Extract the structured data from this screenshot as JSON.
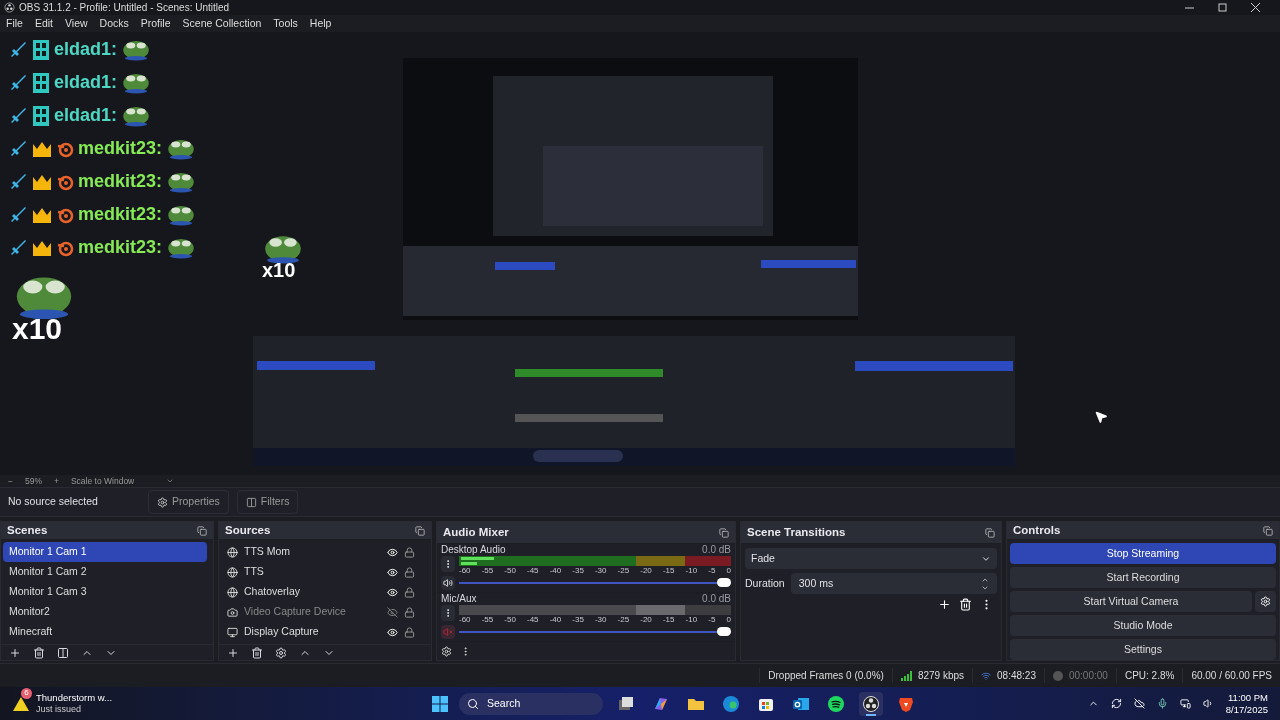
{
  "window": {
    "title": "OBS 31.1.2 - Profile: Untitled - Scenes: Untitled"
  },
  "menu": [
    "File",
    "Edit",
    "View",
    "Docks",
    "Profile",
    "Scene Collection",
    "Tools",
    "Help"
  ],
  "preview": {
    "chat": [
      {
        "user": "eldad1:",
        "color": "#4dd8c4",
        "kind": "og"
      },
      {
        "user": "eldad1:",
        "color": "#4dd8c4",
        "kind": "og"
      },
      {
        "user": "eldad1:",
        "color": "#4dd8c4",
        "kind": "og"
      },
      {
        "user": "medkit23:",
        "color": "#86ea55",
        "kind": "crown"
      },
      {
        "user": "medkit23:",
        "color": "#86ea55",
        "kind": "crown"
      },
      {
        "user": "medkit23:",
        "color": "#86ea55",
        "kind": "crown"
      },
      {
        "user": "medkit23:",
        "color": "#86ea55",
        "kind": "crown"
      }
    ],
    "multipliers": [
      "x10",
      "x10"
    ]
  },
  "zoom_bar": {
    "minus": "−",
    "zoom": "59%",
    "plus": "+",
    "scale": "Scale to Window"
  },
  "source_toolbar": {
    "label": "No source selected",
    "buttons": [
      {
        "kind": "properties",
        "label": "Properties"
      },
      {
        "kind": "filters",
        "label": "Filters"
      }
    ]
  },
  "scenes": {
    "title": "Scenes",
    "items": [
      {
        "label": "Monitor 1 Cam 1",
        "selected": true
      },
      {
        "label": "Monitor 1 Cam 2",
        "selected": false
      },
      {
        "label": "Monitor 1 Cam 3",
        "selected": false
      },
      {
        "label": "Monitor2",
        "selected": false
      },
      {
        "label": "Minecraft",
        "selected": false
      }
    ]
  },
  "sources": {
    "title": "Sources",
    "items": [
      {
        "name": "TTS Mom",
        "kind": "browser",
        "visible": true
      },
      {
        "name": "TTS",
        "kind": "browser",
        "visible": true
      },
      {
        "name": "Chatoverlay",
        "kind": "browser",
        "visible": true
      },
      {
        "name": "Video Capture Device",
        "kind": "camera",
        "visible": false
      },
      {
        "name": "Display Capture",
        "kind": "display",
        "visible": true
      }
    ]
  },
  "audio_mixer": {
    "title": "Audio Mixer",
    "channels": [
      {
        "name": "Desktop Audio",
        "reading": "0.0 dB",
        "muted": false,
        "level": 1,
        "scale": [
          "-60",
          "-55",
          "-50",
          "-45",
          "-40",
          "-35",
          "-30",
          "-25",
          "-20",
          "-15",
          "-10",
          "-5",
          "0"
        ]
      },
      {
        "name": "Mic/Aux",
        "reading": "0.0 dB",
        "muted": true,
        "level": 1,
        "scale": [
          "-60",
          "-55",
          "-50",
          "-45",
          "-40",
          "-35",
          "-30",
          "-25",
          "-20",
          "-15",
          "-10",
          "-5",
          "0"
        ]
      }
    ]
  },
  "scene_transitions": {
    "title": "Scene Transitions",
    "transition": "Fade",
    "duration_label": "Duration",
    "duration": "300 ms"
  },
  "controls": {
    "title": "Controls",
    "buttons": [
      {
        "label": "Stop Streaming",
        "active": true,
        "settings": false
      },
      {
        "label": "Start Recording",
        "active": false,
        "settings": false
      },
      {
        "label": "Start Virtual Camera",
        "active": false,
        "settings": true
      },
      {
        "label": "Studio Mode",
        "active": false,
        "settings": false
      },
      {
        "label": "Settings",
        "active": false,
        "settings": false
      }
    ]
  },
  "status_bar": {
    "dropped": "Dropped Frames 0 (0.0%)",
    "bitrate": "8279 kbps",
    "stream_time": "08:48:23",
    "record_time": "00:00:00",
    "cpu": "CPU: 2.8%",
    "fps": "60.00 / 60.00 FPS"
  },
  "taskbar": {
    "notification": {
      "badge": "6",
      "title": "Thunderstorm w...",
      "subtitle": "Just issued"
    },
    "search": "Search",
    "apps": [
      {
        "kind": "taskview",
        "active": false
      },
      {
        "kind": "copilot",
        "active": false
      },
      {
        "kind": "files",
        "active": false
      },
      {
        "kind": "edge",
        "active": false
      },
      {
        "kind": "store",
        "active": false
      },
      {
        "kind": "outlook",
        "active": false
      },
      {
        "kind": "spotify",
        "active": false
      },
      {
        "kind": "obs",
        "active": true
      },
      {
        "kind": "brave",
        "active": false
      }
    ],
    "time": "11:00 PM",
    "date": "8/17/2025"
  }
}
